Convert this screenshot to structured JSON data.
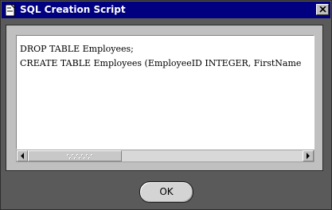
{
  "window": {
    "title": "SQL Creation Script",
    "close_icon": "close-icon",
    "app_icon": "document-icon"
  },
  "script": {
    "lines": [
      "DROP TABLE Employees;",
      "CREATE TABLE Employees (EmployeeID INTEGER, FirstName"
    ]
  },
  "scrollbar": {
    "left_icon": "arrow-left-icon",
    "right_icon": "arrow-right-icon"
  },
  "buttons": {
    "ok_label": "OK"
  },
  "colors": {
    "titlebar": "#000080",
    "window_bg": "#5a5a5a",
    "panel_bg": "#c0c0c0"
  }
}
